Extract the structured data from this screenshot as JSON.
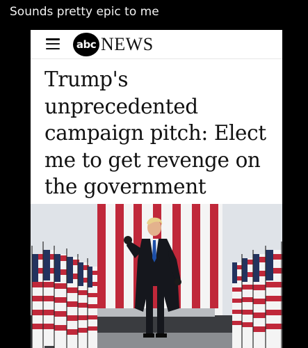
{
  "post": {
    "caption": "Sounds pretty epic to me"
  },
  "nav": {
    "menu_icon": "hamburger-menu-icon",
    "logo_disc_text": "abc",
    "logo_word": "NEWS"
  },
  "article": {
    "headline": "Trump's unprecedented campaign pitch: Elect me to get revenge on the government"
  },
  "photo": {
    "subject": "man-in-dark-coat-raising-fist-flags-background"
  },
  "colors": {
    "flag_red": "#c0283a",
    "flag_white": "#f4f4f4",
    "flag_blue": "#23335e",
    "coat": "#15171d",
    "tie": "#1d4fa8"
  }
}
